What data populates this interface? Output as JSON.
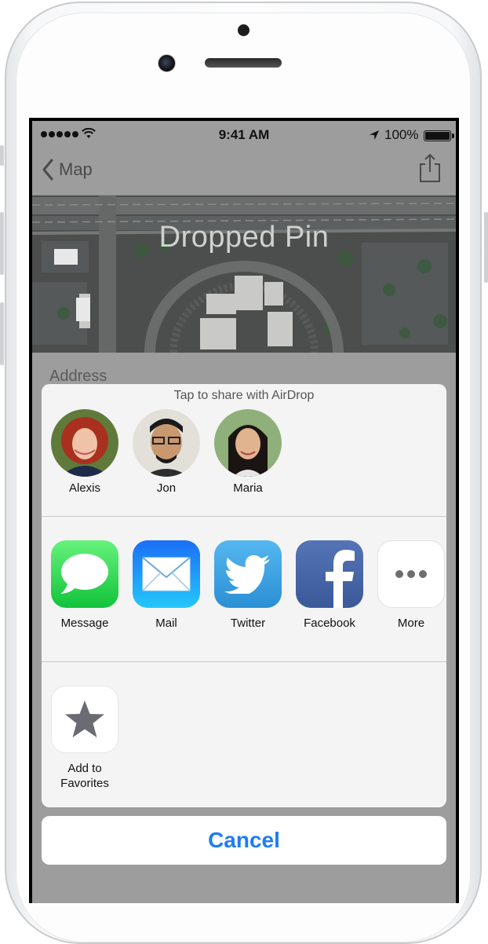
{
  "status_bar": {
    "time": "9:41 AM",
    "battery": "100%"
  },
  "navbar": {
    "back_label": "Map",
    "share_icon": "share-icon"
  },
  "map": {
    "title": "Dropped Pin"
  },
  "address_label": "Address",
  "share_sheet": {
    "airdrop_title": "Tap to share with AirDrop",
    "people": [
      {
        "name": "Alexis"
      },
      {
        "name": "Jon"
      },
      {
        "name": "Maria"
      }
    ],
    "apps": [
      {
        "label": "Message",
        "icon": "message-icon",
        "color": "#3ad35a"
      },
      {
        "label": "Mail",
        "icon": "mail-icon",
        "color": "#1e8ff5"
      },
      {
        "label": "Twitter",
        "icon": "twitter-icon",
        "color": "#35a4e6"
      },
      {
        "label": "Facebook",
        "icon": "facebook-icon",
        "color": "#3b5998"
      },
      {
        "label": "More",
        "icon": "more-icon",
        "color": "#ffffff"
      }
    ],
    "actions": [
      {
        "label": "Add to\nFavorites",
        "icon": "star-icon"
      }
    ]
  },
  "cancel_label": "Cancel",
  "colors": {
    "accent": "#1d7cf6",
    "dim_overlay": "#9d9d9d"
  }
}
